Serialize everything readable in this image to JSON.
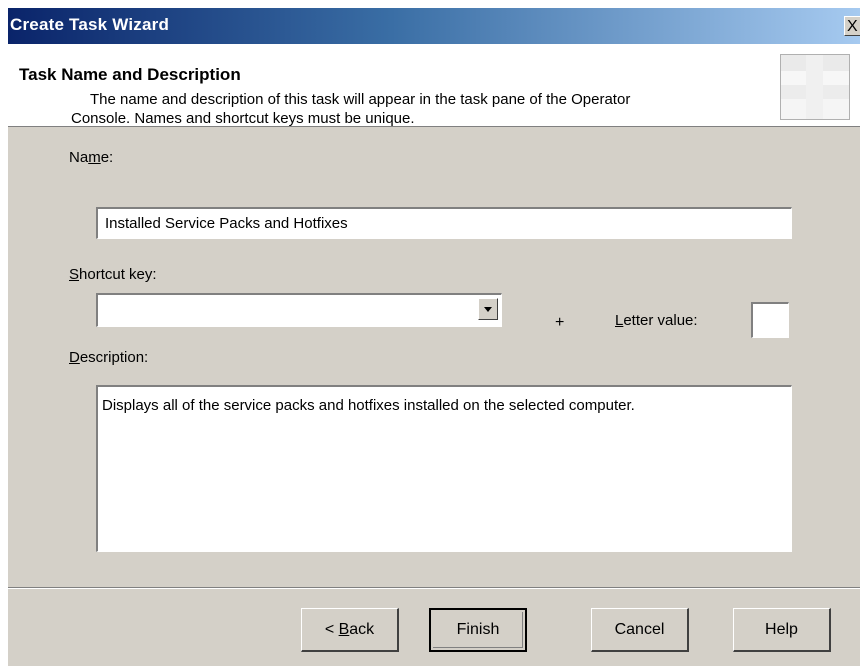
{
  "window": {
    "title": "Create Task Wizard",
    "close_glyph": "X"
  },
  "header": {
    "title": "Task Name and Description",
    "description_line1": "The name and description of this task will appear in the task pane of the Operator",
    "description_line2": "Console. Names and shortcut keys must be unique.",
    "image_icon": "wizard-header-graphic"
  },
  "form": {
    "name_label_pre": "Na",
    "name_label_accel": "m",
    "name_label_post": "e:",
    "name_value": "Installed Service Packs and Hotfixes",
    "shortcut_label_accel": "S",
    "shortcut_label_post": "hortcut key:",
    "shortcut_value": "",
    "plus_sign": "+",
    "letter_label_accel": "L",
    "letter_label_post": "etter value:",
    "letter_value": "",
    "description_label_accel": "D",
    "description_label_post": "escription:",
    "description_value": "Displays all of the service packs and hotfixes installed on the selected computer."
  },
  "buttons": {
    "back_prefix": "< ",
    "back_accel": "B",
    "back_post": "ack",
    "finish": "Finish",
    "cancel": "Cancel",
    "help": "Help"
  },
  "colors": {
    "title_gradient_start": "#0a246a",
    "title_gradient_end": "#a6caf0",
    "dialog_face": "#d4d0c8"
  }
}
